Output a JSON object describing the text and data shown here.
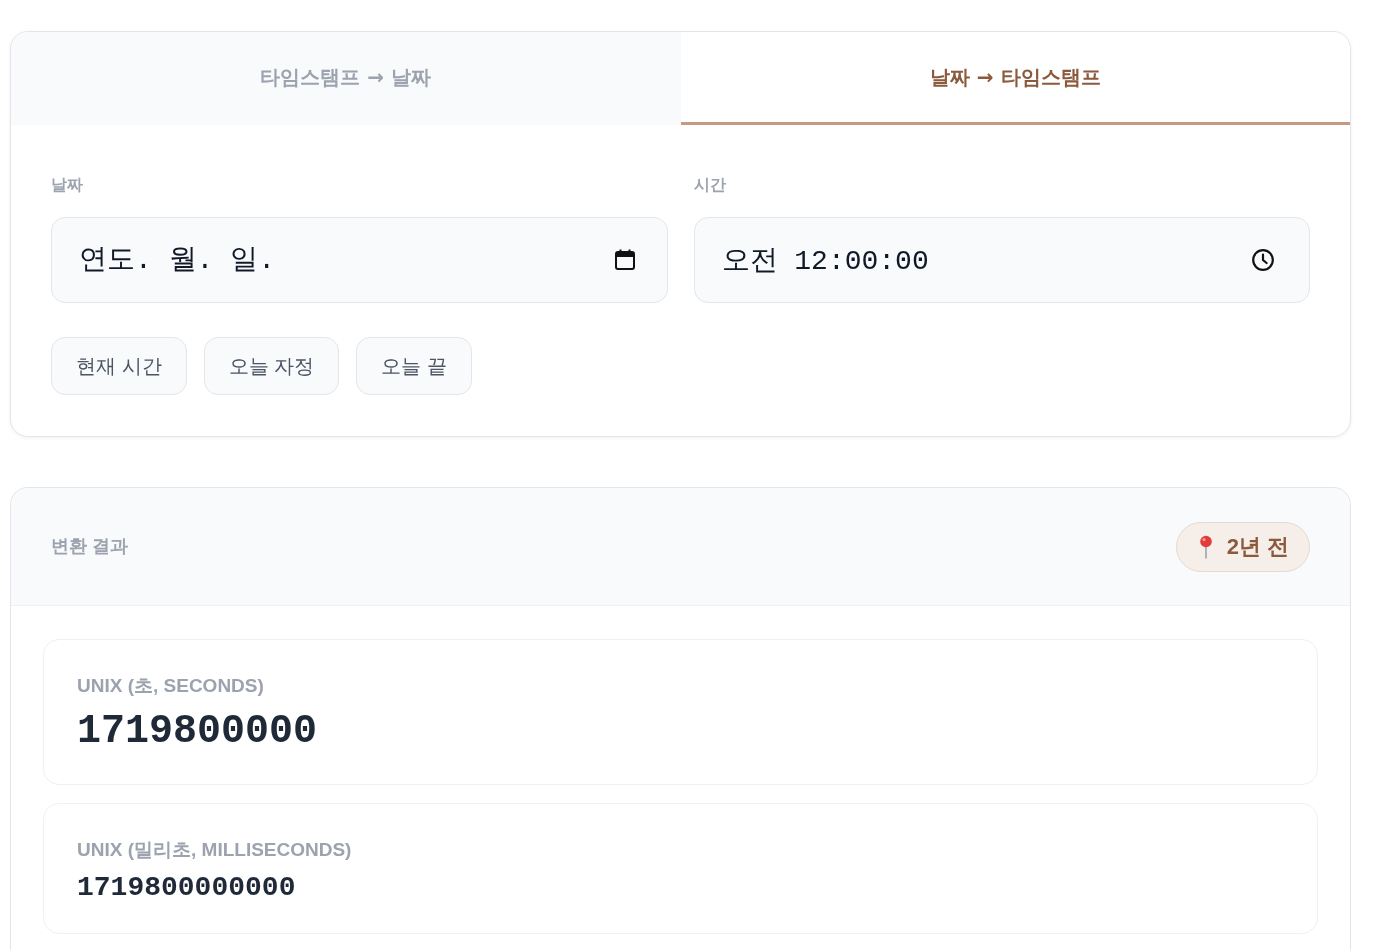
{
  "tabs": [
    {
      "label": "타임스탬프 → 날짜",
      "selected": false
    },
    {
      "label": "날짜 → 타임스탬프",
      "selected": true
    }
  ],
  "fields": [
    {
      "kind": "date",
      "label": "날짜",
      "placeholder": "연도. 월. 일."
    },
    {
      "kind": "time",
      "label": "시간",
      "value": "오전 12:00:00"
    }
  ],
  "presets": [
    "현재 시간",
    "오늘 자정",
    "오늘 끝"
  ],
  "result": {
    "title": "변환 결과",
    "badge": "2년 전",
    "items": [
      {
        "kind": "primary",
        "label": "UNIX (초, SECONDS)",
        "value": "1719800000"
      },
      {
        "kind": "secondary",
        "label": "UNIX (밀리초, MILLISECONDS)",
        "value": "1719800000000"
      }
    ]
  }
}
